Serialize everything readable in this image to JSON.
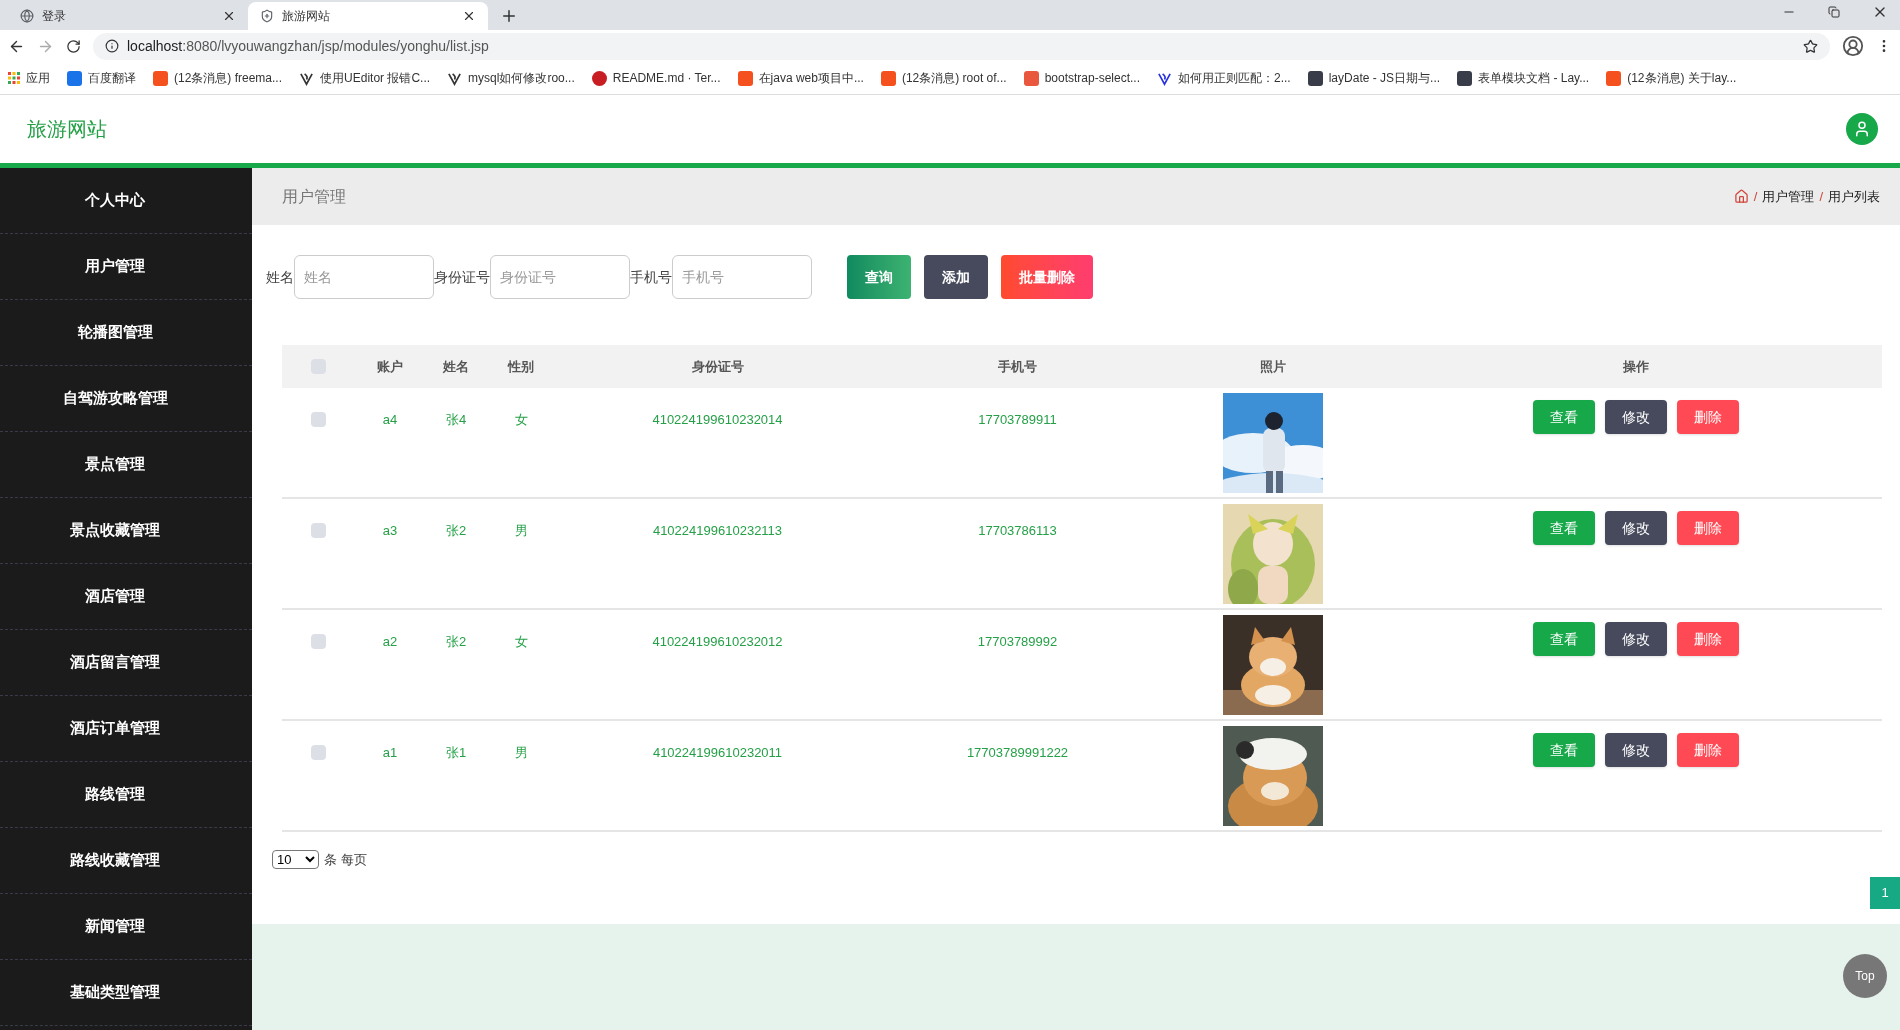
{
  "browser": {
    "tabs": [
      {
        "title": "登录",
        "selected": false
      },
      {
        "title": "旅游网站",
        "selected": true
      }
    ],
    "url_host": "localhost",
    "url_rest": ":8080/lvyouwangzhan/jsp/modules/yonghu/list.jsp",
    "bookmarks": [
      {
        "label": "应用",
        "kind": "apps"
      },
      {
        "label": "百度翻译",
        "kind": "square",
        "color": "#1a73e8"
      },
      {
        "label": "(12条消息) freema...",
        "kind": "square",
        "color": "#f4511e"
      },
      {
        "label": "使用UEditor 报错C...",
        "kind": "glyph",
        "color": "#333333"
      },
      {
        "label": "mysql如何修改roo...",
        "kind": "glyph",
        "color": "#333333"
      },
      {
        "label": "README.md · Ter...",
        "kind": "circle",
        "color": "#c71d23"
      },
      {
        "label": "在java web项目中...",
        "kind": "square",
        "color": "#f4511e"
      },
      {
        "label": "(12条消息) root of...",
        "kind": "square",
        "color": "#f4511e"
      },
      {
        "label": "bootstrap-select...",
        "kind": "square",
        "color": "#e9573f"
      },
      {
        "label": "如何用正则匹配：2...",
        "kind": "glyph",
        "color": "#2932e1"
      },
      {
        "label": "layDate - JS日期与...",
        "kind": "square",
        "color": "#393d49"
      },
      {
        "label": "表单模块文档 - Lay...",
        "kind": "square",
        "color": "#393d49"
      },
      {
        "label": "(12条消息) 关于lay...",
        "kind": "square",
        "color": "#f4511e"
      }
    ]
  },
  "site": {
    "title": "旅游网站"
  },
  "sidebar": {
    "items": [
      "个人中心",
      "用户管理",
      "轮播图管理",
      "自驾游攻略管理",
      "景点管理",
      "景点收藏管理",
      "酒店管理",
      "酒店留言管理",
      "酒店订单管理",
      "路线管理",
      "路线收藏管理",
      "新闻管理",
      "基础类型管理"
    ]
  },
  "page_title": "用户管理",
  "breadcrumb": [
    {
      "separator": "/",
      "label": "用户管理"
    },
    {
      "separator": "/",
      "label": "用户列表"
    }
  ],
  "search": {
    "fields": [
      {
        "label": "姓名",
        "placeholder": "姓名"
      },
      {
        "label": "身份证号",
        "placeholder": "身份证号"
      },
      {
        "label": "手机号",
        "placeholder": "手机号"
      }
    ],
    "buttons": [
      {
        "label": "查询",
        "kind": "query"
      },
      {
        "label": "添加",
        "kind": "add"
      },
      {
        "label": "批量删除",
        "kind": "delete"
      }
    ]
  },
  "table": {
    "columns": [
      "账户",
      "姓名",
      "性别",
      "身份证号",
      "手机号",
      "照片",
      "操作"
    ],
    "header_checked": false,
    "rows": [
      {
        "checked": false,
        "account": "a4",
        "name": "张4",
        "gender": "女",
        "id_number": "410224199610232014",
        "phone": "17703789911",
        "photo": {
          "kind": "picture"
        },
        "actions": [
          {
            "label": "查看",
            "kind": "view"
          },
          {
            "label": "修改",
            "kind": "edit"
          },
          {
            "label": "删除",
            "kind": "delete"
          }
        ]
      },
      {
        "checked": false,
        "account": "a3",
        "name": "张2",
        "gender": "男",
        "id_number": "410224199610232113",
        "phone": "17703786113",
        "photo": {
          "kind": "picture"
        },
        "actions": [
          {
            "label": "查看",
            "kind": "view"
          },
          {
            "label": "修改",
            "kind": "edit"
          },
          {
            "label": "删除",
            "kind": "delete"
          }
        ]
      },
      {
        "checked": false,
        "account": "a2",
        "name": "张2",
        "gender": "女",
        "id_number": "410224199610232012",
        "phone": "17703789992",
        "photo": {
          "kind": "picture"
        },
        "actions": [
          {
            "label": "查看",
            "kind": "view"
          },
          {
            "label": "修改",
            "kind": "edit"
          },
          {
            "label": "删除",
            "kind": "delete"
          }
        ]
      },
      {
        "checked": false,
        "account": "a1",
        "name": "张1",
        "gender": "男",
        "id_number": "410224199610232011",
        "phone": "17703789991222",
        "photo": {
          "kind": "picture"
        },
        "actions": [
          {
            "label": "查看",
            "kind": "view"
          },
          {
            "label": "修改",
            "kind": "edit"
          },
          {
            "label": "删除",
            "kind": "delete"
          }
        ]
      }
    ]
  },
  "pagination": {
    "page_size": "10",
    "page_size_suffix": "条 每页",
    "pages": [
      {
        "label": "1",
        "selected": true
      }
    ]
  },
  "back_to_top": "Top"
}
